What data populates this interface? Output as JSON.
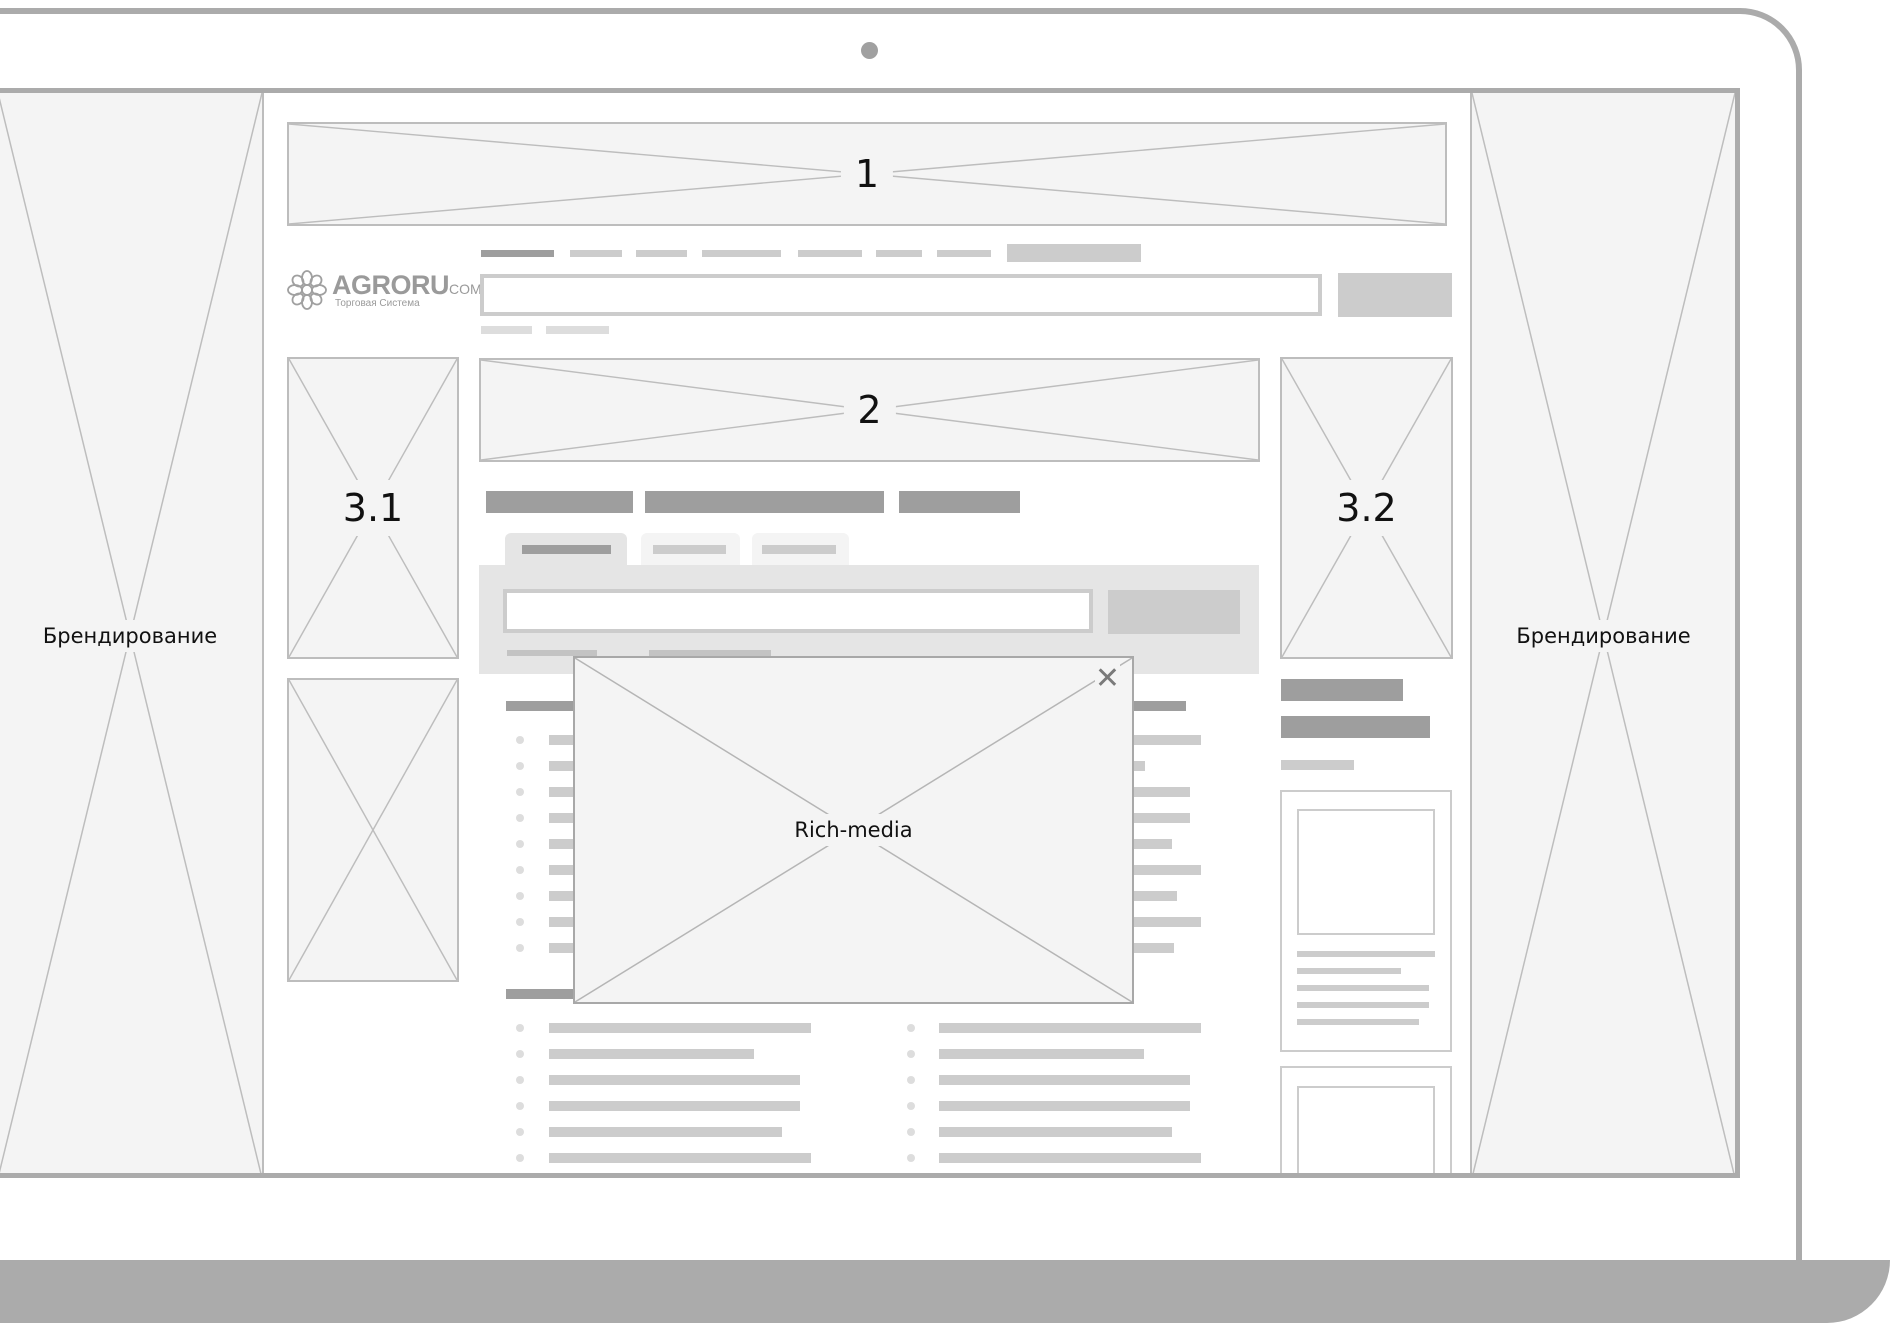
{
  "branding": {
    "left_label": "Брендирование",
    "right_label": "Брендирование"
  },
  "banners": {
    "top": "1",
    "content": "2",
    "side_left": "3.1",
    "side_right": "3.2",
    "popup": "Rich-media"
  },
  "logo": {
    "name": "AGRORU",
    "suffix": "COM",
    "tagline": "Торговая Система"
  },
  "popup_close_glyph": "✕",
  "colors": {
    "frame": "#ababab",
    "placeholder_fill": "#f4f4f4",
    "placeholder_line": "#bdbdbd",
    "skeleton": "#cccccc",
    "skeleton_dark": "#9e9e9e"
  }
}
